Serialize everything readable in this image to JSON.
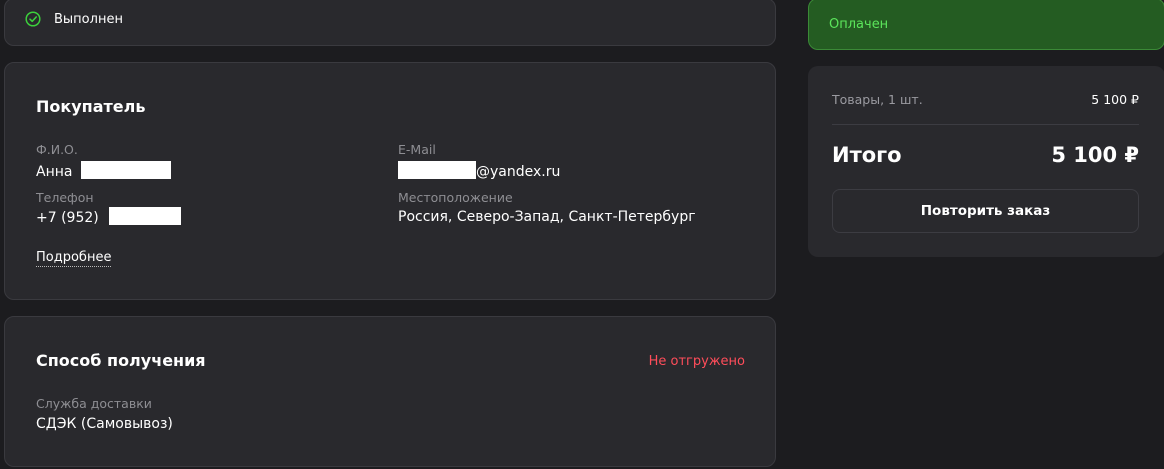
{
  "status": {
    "label": "Выполнен",
    "icon": "check-circle-icon",
    "color": "#3ccf3c"
  },
  "buyer": {
    "title": "Покупатель",
    "name_label": "Ф.И.О.",
    "name_value": "Анна",
    "phone_label": "Телефон",
    "phone_value": "+7 (952)",
    "email_label": "E-Mail",
    "email_value": "@yandex.ru",
    "location_label": "Местоположение",
    "location_value": "Россия, Северо-Запад, Санкт-Петербург",
    "more_link": "Подробнее"
  },
  "delivery": {
    "title": "Способ получения",
    "status": "Не отгружено",
    "status_color": "#ff4d5a",
    "service_label": "Служба доставки",
    "service_value": "СДЭК (Самовывоз)"
  },
  "payment": {
    "status": "Оплачен",
    "status_color": "#5be55b"
  },
  "summary": {
    "items_label": "Товары, 1 шт.",
    "items_amount": "5 100 ₽",
    "total_label": "Итого",
    "total_amount": "5 100 ₽",
    "repeat_button": "Повторить заказ"
  }
}
